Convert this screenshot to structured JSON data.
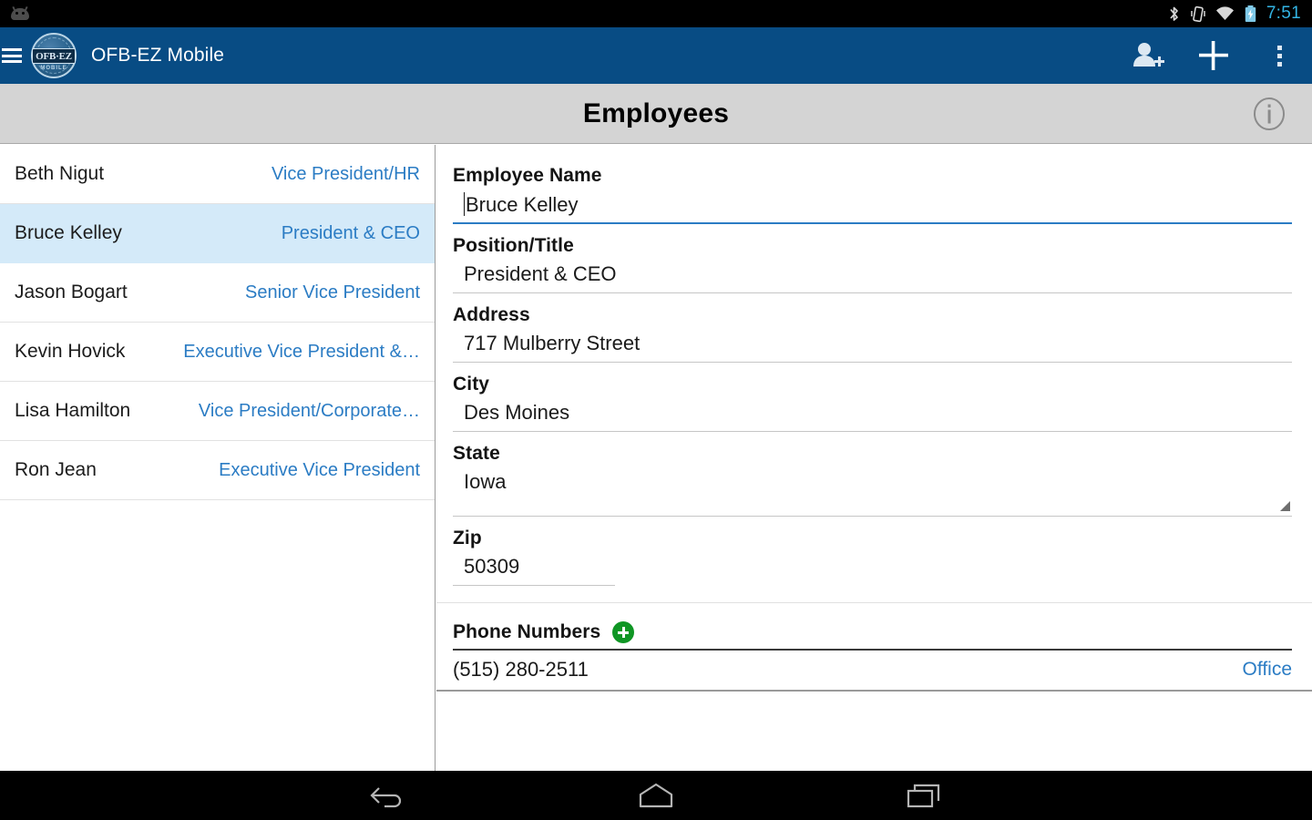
{
  "status_bar": {
    "time": "7:51",
    "icons": [
      "android-robot-icon",
      "bluetooth-icon",
      "vibrate-icon",
      "wifi-icon",
      "battery-charging-icon"
    ],
    "time_color": "#33b5e5"
  },
  "app_bar": {
    "title": "OFB-EZ Mobile",
    "logo_text": "OFB·EZ",
    "logo_subtext": "MOBILE",
    "background_color": "#084c84",
    "actions": [
      {
        "name": "add-person-icon",
        "label": "Add Person"
      },
      {
        "name": "add-icon",
        "label": "Add"
      },
      {
        "name": "overflow-menu-icon",
        "label": "More options"
      }
    ],
    "menu_label": "Menu"
  },
  "title_bar": {
    "title": "Employees",
    "info_label": "Info",
    "background_color": "#d4d4d4"
  },
  "employee_list": {
    "rows": [
      {
        "name": "Beth Nigut",
        "title": "Vice President/HR",
        "selected": false
      },
      {
        "name": "Bruce Kelley",
        "title": "President & CEO",
        "selected": true
      },
      {
        "name": "Jason Bogart",
        "title": "Senior Vice President",
        "selected": false
      },
      {
        "name": "Kevin Hovick",
        "title": "Executive Vice President &…",
        "selected": false
      },
      {
        "name": "Lisa Hamilton",
        "title": "Vice President/Corporate…",
        "selected": false
      },
      {
        "name": "Ron Jean",
        "title": "Executive Vice President",
        "selected": false
      }
    ],
    "selected_row_color": "#d4eaf9",
    "title_color": "#2b7cc4"
  },
  "detail_form": {
    "employee_name": {
      "label": "Employee Name",
      "value": "Bruce Kelley",
      "focused": true
    },
    "position_title": {
      "label": "Position/Title",
      "value": "President & CEO"
    },
    "address": {
      "label": "Address",
      "value": "717 Mulberry Street"
    },
    "city": {
      "label": "City",
      "value": "Des Moines"
    },
    "state": {
      "label": "State",
      "value": "Iowa",
      "control": "spinner"
    },
    "zip": {
      "label": "Zip",
      "value": "50309"
    },
    "phone_section": {
      "label": "Phone Numbers",
      "add_label": "Add phone number",
      "rows": [
        {
          "number": "(515) 280-2511",
          "type": "Office"
        }
      ]
    },
    "accent_color": "#2b7cc4",
    "add_button_color": "#0f9624"
  },
  "nav_bar": {
    "buttons": [
      {
        "name": "back-icon",
        "label": "Back"
      },
      {
        "name": "home-icon",
        "label": "Home"
      },
      {
        "name": "recents-icon",
        "label": "Recent apps"
      }
    ]
  }
}
